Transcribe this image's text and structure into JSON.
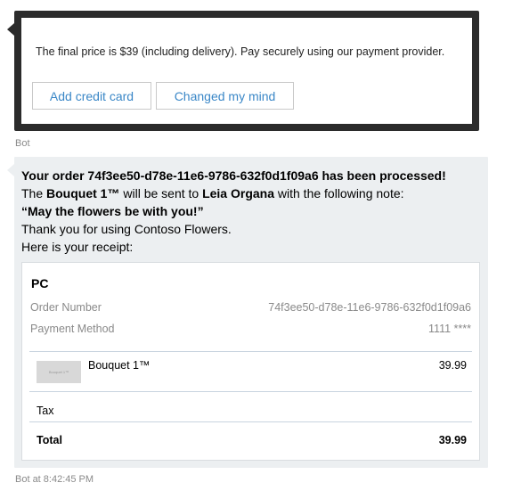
{
  "card": {
    "price_text": "The final price is $39 (including delivery). Pay securely using our payment provider.",
    "add_credit_card_label": "Add credit card",
    "changed_mind_label": "Changed my mind"
  },
  "meta1": "Bot",
  "message": {
    "line1": "Your order 74f3ee50-d78e-11e6-9786-632f0d1f09a6 has been processed!",
    "line2_a": "The ",
    "line2_item": "Bouquet 1™",
    "line2_b": " will be sent to ",
    "line2_name": "Leia Organa",
    "line2_c": " with the following note:",
    "line3": "“May the flowers be with you!”",
    "line4": "Thank you for using Contoso Flowers.",
    "line5": "Here is your receipt:"
  },
  "receipt": {
    "title": "PC",
    "order_number_label": "Order Number",
    "order_number_value": "74f3ee50-d78e-11e6-9786-632f0d1f09a6",
    "payment_method_label": "Payment Method",
    "payment_method_value": "1111 ****",
    "items": [
      {
        "name": "Bouquet 1™",
        "price": "39.99",
        "image_icon": "bouquet-image"
      }
    ],
    "tax_label": "Tax",
    "total_label": "Total",
    "total_value": "39.99"
  },
  "meta2": "Bot at 8:42:45 PM",
  "colors": {
    "accent": "#3a87c7",
    "card_border": "#2b2b2b",
    "bubble_bg": "#eceff1",
    "muted_text": "#8a8a8a"
  }
}
